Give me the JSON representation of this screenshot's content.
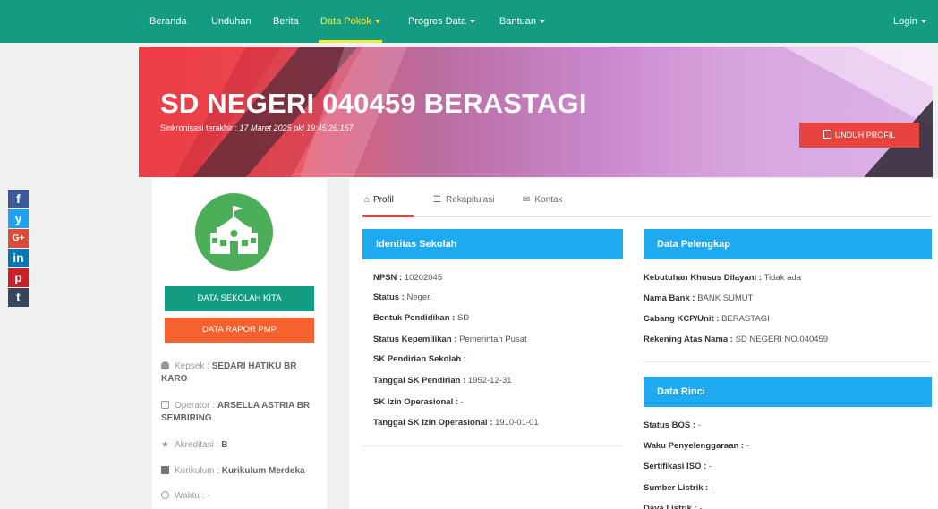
{
  "nav": {
    "items": [
      {
        "label": "Beranda"
      },
      {
        "label": "Unduhan"
      },
      {
        "label": "Berita"
      },
      {
        "label": "Data Pokok"
      },
      {
        "label": "Progres Data"
      },
      {
        "label": "Bantuan"
      }
    ],
    "login": "Login"
  },
  "banner": {
    "title": "SD NEGERI 040459 BERASTAGI",
    "sync_label": "Sinkronisasi terakhir : ",
    "sync_time": "17 Maret 2025 pkl 19:45:26.157",
    "download_button": "UNDUH PROFIL"
  },
  "social": [
    "f",
    "y",
    "G+",
    "in",
    "p",
    "t"
  ],
  "colors": {
    "nav_bg": "#139c82",
    "nav_active": "#f7ea3c",
    "panel_head": "#1eaaf1",
    "btn_green": "#139c82",
    "btn_orange": "#f5612f",
    "btn_red": "#e8443f"
  },
  "sidebar": {
    "btn_data_sekolah": "DATA SEKOLAH KITA",
    "btn_data_rapor": "DATA RAPOR PMP",
    "kepsek_label": "Kepsek : ",
    "kepsek_value": "SEDARI HATIKU BR KARO",
    "operator_label": "Operator : ",
    "operator_value": "ARSELLA ASTRIA BR SEMBIRING",
    "akreditasi_label": "Akreditasi : ",
    "akreditasi_value": "B",
    "kurikulum_label": "Kurikulum : ",
    "kurikulum_value": "Kurikulum Merdeka",
    "waktu_label": "Waktu : ",
    "waktu_value": "-"
  },
  "tabs": {
    "profil": "Profil",
    "rekapitulasi": "Rekapitulasi",
    "kontak": "Kontak"
  },
  "identitas": {
    "title": "Identitas Sekolah",
    "rows": [
      {
        "key": "NPSN : ",
        "value": "10202045"
      },
      {
        "key": "Status : ",
        "value": "Negeri"
      },
      {
        "key": "Bentuk Pendidikan : ",
        "value": "SD"
      },
      {
        "key": "Status Kepemilikan : ",
        "value": "Pemerintah Pusat"
      },
      {
        "key": "SK Pendirian Sekolah : ",
        "value": ""
      },
      {
        "key": "Tanggal SK Pendirian : ",
        "value": "1952-12-31"
      },
      {
        "key": "SK Izin Operasional : ",
        "value": "-"
      },
      {
        "key": "Tanggal SK Izin Operasional : ",
        "value": "1910-01-01"
      }
    ]
  },
  "pelengkap": {
    "title": "Data Pelengkap",
    "rows": [
      {
        "key": "Kebutuhan Khusus Dilayani : ",
        "value": "Tidak ada"
      },
      {
        "key": "Nama Bank : ",
        "value": "BANK SUMUT"
      },
      {
        "key": "Cabang KCP/Unit : ",
        "value": "BERASTAGI"
      },
      {
        "key": "Rekening Atas Nama : ",
        "value": "SD NEGERI NO.040459"
      }
    ]
  },
  "rinci": {
    "title": "Data Rinci",
    "rows": [
      {
        "key": "Status BOS : ",
        "value": "-"
      },
      {
        "key": "Waku Penyelenggaraan : ",
        "value": "-"
      },
      {
        "key": "Sertifikasi ISO : ",
        "value": "-"
      },
      {
        "key": "Sumber Listrik : ",
        "value": "-"
      },
      {
        "key": "Daya Listrik : ",
        "value": "-"
      }
    ]
  }
}
